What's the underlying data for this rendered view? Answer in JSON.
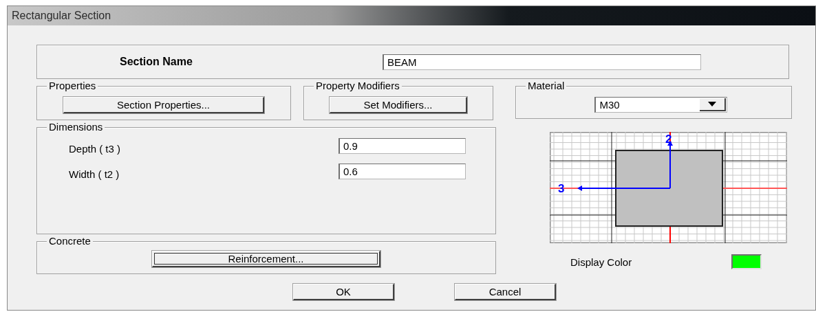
{
  "window": {
    "title": "Rectangular Section"
  },
  "section_name": {
    "label": "Section Name",
    "value": "BEAM"
  },
  "properties": {
    "title": "Properties",
    "button": "Section Properties..."
  },
  "property_modifiers": {
    "title": "Property Modifiers",
    "button": "Set Modifiers..."
  },
  "material": {
    "title": "Material",
    "value": "M30"
  },
  "dimensions": {
    "title": "Dimensions",
    "fields": [
      {
        "label": "Depth  ( t3 )",
        "value": "0.9"
      },
      {
        "label": "Width  ( t2 )",
        "value": "0.6"
      }
    ]
  },
  "concrete": {
    "title": "Concrete",
    "button": "Reinforcement...",
    "focused": true
  },
  "preview": {
    "axis_labels": [
      "2",
      "3"
    ]
  },
  "display_color": {
    "label": "Display Color",
    "color": "#00ff00"
  },
  "buttons": [
    "OK",
    "Cancel"
  ]
}
